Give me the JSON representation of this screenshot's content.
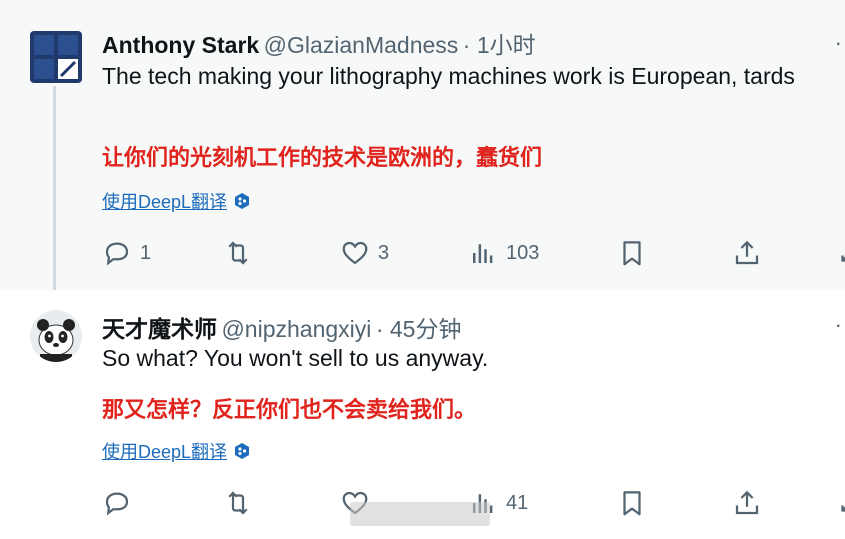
{
  "tweets": [
    {
      "author_name": "Anthony Stark",
      "handle": "@GlazianMadness",
      "time": "· 1小时",
      "text": "The tech making your lithography machines work is European, tards",
      "translation": "让你们的光刻机工作的技术是欧洲的，蠢货们",
      "deepl_link": "使用DeepL翻译",
      "reply_count": "1",
      "retweet_count": "",
      "like_count": "3",
      "view_count": "103"
    },
    {
      "author_name": "天才魔术师",
      "handle": "@nipzhangxiyi",
      "time": "· 45分钟",
      "text": "So what? You won't sell to us anyway.",
      "translation": "那又怎样？反正你们也不会卖给我们。",
      "deepl_link": "使用DeepL翻译",
      "reply_count": "",
      "retweet_count": "",
      "like_count": "",
      "view_count": "41"
    }
  ],
  "more_label": "·",
  "colors": {
    "translation": "#e0231c",
    "link": "#1d6bbb",
    "muted": "#536471",
    "thread_bg": "#f7f9f9"
  }
}
